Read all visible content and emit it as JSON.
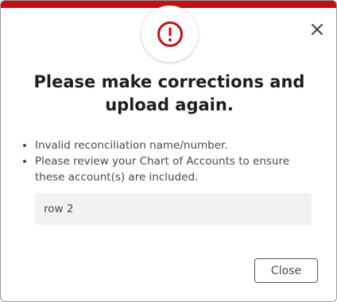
{
  "dialog": {
    "title": "Please make corrections and upload again.",
    "errors": [
      "Invalid reconciliation name/number.",
      "Please review your Chart of Accounts to ensure these account(s) are included."
    ],
    "detail_value": "row 2",
    "close_label": "Close",
    "icons": {
      "alert": "exclamation-circle-icon",
      "dismiss": "close-icon"
    },
    "colors": {
      "accent": "#c40f15",
      "text": "#1e1e1e",
      "body_text": "#4a4a4a",
      "detail_background": "#f2f2f2"
    }
  }
}
